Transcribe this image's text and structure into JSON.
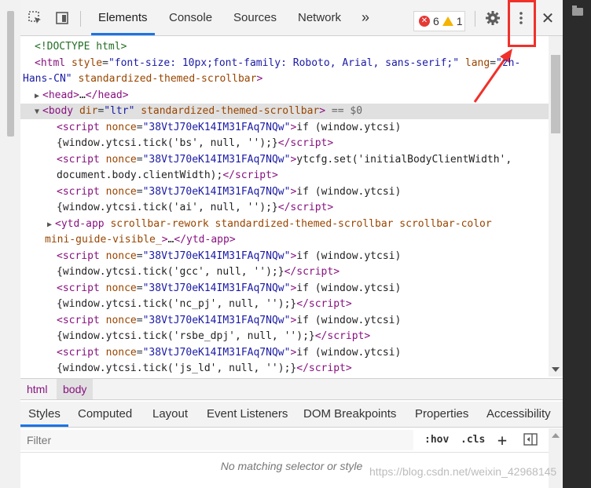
{
  "toolbar": {
    "tabs": [
      {
        "label": "Elements",
        "active": true
      },
      {
        "label": "Console",
        "active": false
      },
      {
        "label": "Sources",
        "active": false
      },
      {
        "label": "Network",
        "active": false
      }
    ],
    "more_tabs_label": "»",
    "errors_count": "6",
    "warnings_count": "1",
    "settings_icon": "gear-icon",
    "menu_icon": "kebab-menu-icon",
    "close_label": "✕"
  },
  "elements": {
    "lines": [
      {
        "html": "<span class='cmt'>&lt;!DOCTYPE html&gt;</span>"
      },
      {
        "html": "<span class='tag'>&lt;html</span> <span class='attr'>style</span>=<span class='val'>\"font-size: 10px;font-family: Roboto, Arial, sans-serif;\"</span> <span class='attr'>lang</span>=<span class='val'>\"zh-</span>"
      },
      {
        "html": "<span class='val'>Hans-CN\"</span> <span class='attr'>standardized-themed-scrollbar</span><span class='tag'>&gt;</span>"
      },
      {
        "html": "<span class='tri'>▶</span><span class='tag'>&lt;head&gt;</span><span class='txt'>…</span><span class='tag'>&lt;/head&gt;</span>"
      },
      {
        "html": "<span class='tri'>▼</span><span class='tag'>&lt;body</span> <span class='attr'>dir</span>=<span class='val'>\"ltr\"</span> <span class='attr'>standardized-themed-scrollbar</span><span class='tag'>&gt;</span> <span class='gray'>== $0</span>"
      },
      {
        "html": "<span class='tag'>&lt;script</span> <span class='attr'>nonce</span>=<span class='val'>\"38VtJ70eK14IM31FAq7NQw\"</span><span class='tag'>&gt;</span><span class='txt'>if (window.ytcsi)</span>"
      },
      {
        "html": "<span class='txt'>{window.ytcsi.tick('bs', null, '');}</span><span class='tag'>&lt;/script&gt;</span>"
      },
      {
        "html": "<span class='tag'>&lt;script</span> <span class='attr'>nonce</span>=<span class='val'>\"38VtJ70eK14IM31FAq7NQw\"</span><span class='tag'>&gt;</span><span class='txt'>ytcfg.set('initialBodyClientWidth',</span>"
      },
      {
        "html": "<span class='txt'>document.body.clientWidth);</span><span class='tag'>&lt;/script&gt;</span>"
      },
      {
        "html": "<span class='tag'>&lt;script</span> <span class='attr'>nonce</span>=<span class='val'>\"38VtJ70eK14IM31FAq7NQw\"</span><span class='tag'>&gt;</span><span class='txt'>if (window.ytcsi)</span>"
      },
      {
        "html": "<span class='txt'>{window.ytcsi.tick('ai', null, '');}</span><span class='tag'>&lt;/script&gt;</span>"
      },
      {
        "html": "<span class='tri'>▶</span><span class='tag'>&lt;ytd-app</span> <span class='attr'>scrollbar-rework standardized-themed-scrollbar scrollbar-color</span>"
      },
      {
        "html": "<span class='attr'>mini-guide-visible_</span><span class='tag'>&gt;</span><span class='txt'>…</span><span class='tag'>&lt;/ytd-app&gt;</span>"
      },
      {
        "html": "<span class='tag'>&lt;script</span> <span class='attr'>nonce</span>=<span class='val'>\"38VtJ70eK14IM31FAq7NQw\"</span><span class='tag'>&gt;</span><span class='txt'>if (window.ytcsi)</span>"
      },
      {
        "html": "<span class='txt'>{window.ytcsi.tick('gcc', null, '');}</span><span class='tag'>&lt;/script&gt;</span>"
      },
      {
        "html": "<span class='tag'>&lt;script</span> <span class='attr'>nonce</span>=<span class='val'>\"38VtJ70eK14IM31FAq7NQw\"</span><span class='tag'>&gt;</span><span class='txt'>if (window.ytcsi)</span>"
      },
      {
        "html": "<span class='txt'>{window.ytcsi.tick('nc_pj', null, '');}</span><span class='tag'>&lt;/script&gt;</span>"
      },
      {
        "html": "<span class='tag'>&lt;script</span> <span class='attr'>nonce</span>=<span class='val'>\"38VtJ70eK14IM31FAq7NQw\"</span><span class='tag'>&gt;</span><span class='txt'>if (window.ytcsi)</span>"
      },
      {
        "html": "<span class='txt'>{window.ytcsi.tick('rsbe_dpj', null, '');}</span><span class='tag'>&lt;/script&gt;</span>"
      },
      {
        "html": "<span class='tag'>&lt;script</span> <span class='attr'>nonce</span>=<span class='val'>\"38VtJ70eK14IM31FAq7NQw\"</span><span class='tag'>&gt;</span><span class='txt'>if (window.ytcsi)</span>"
      },
      {
        "html": "<span class='txt'>{window.ytcsi.tick('js_ld', null, '');}</span><span class='tag'>&lt;/script&gt;</span>"
      }
    ]
  },
  "breadcrumb": [
    {
      "label": "html",
      "active": false
    },
    {
      "label": "body",
      "active": true
    }
  ],
  "styles_tabs": [
    {
      "label": "Styles",
      "active": true
    },
    {
      "label": "Computed",
      "active": false
    },
    {
      "label": "Layout",
      "active": false
    },
    {
      "label": "Event Listeners",
      "active": false
    },
    {
      "label": "DOM Breakpoints",
      "active": false
    },
    {
      "label": "Properties",
      "active": false
    },
    {
      "label": "Accessibility",
      "active": false
    }
  ],
  "filter": {
    "placeholder": "Filter",
    "hov_label": ":hov",
    "cls_label": ".cls",
    "add_label": "+"
  },
  "empty_message": "No matching selector or style",
  "watermark": "https://blog.csdn.net/weixin_42968145"
}
